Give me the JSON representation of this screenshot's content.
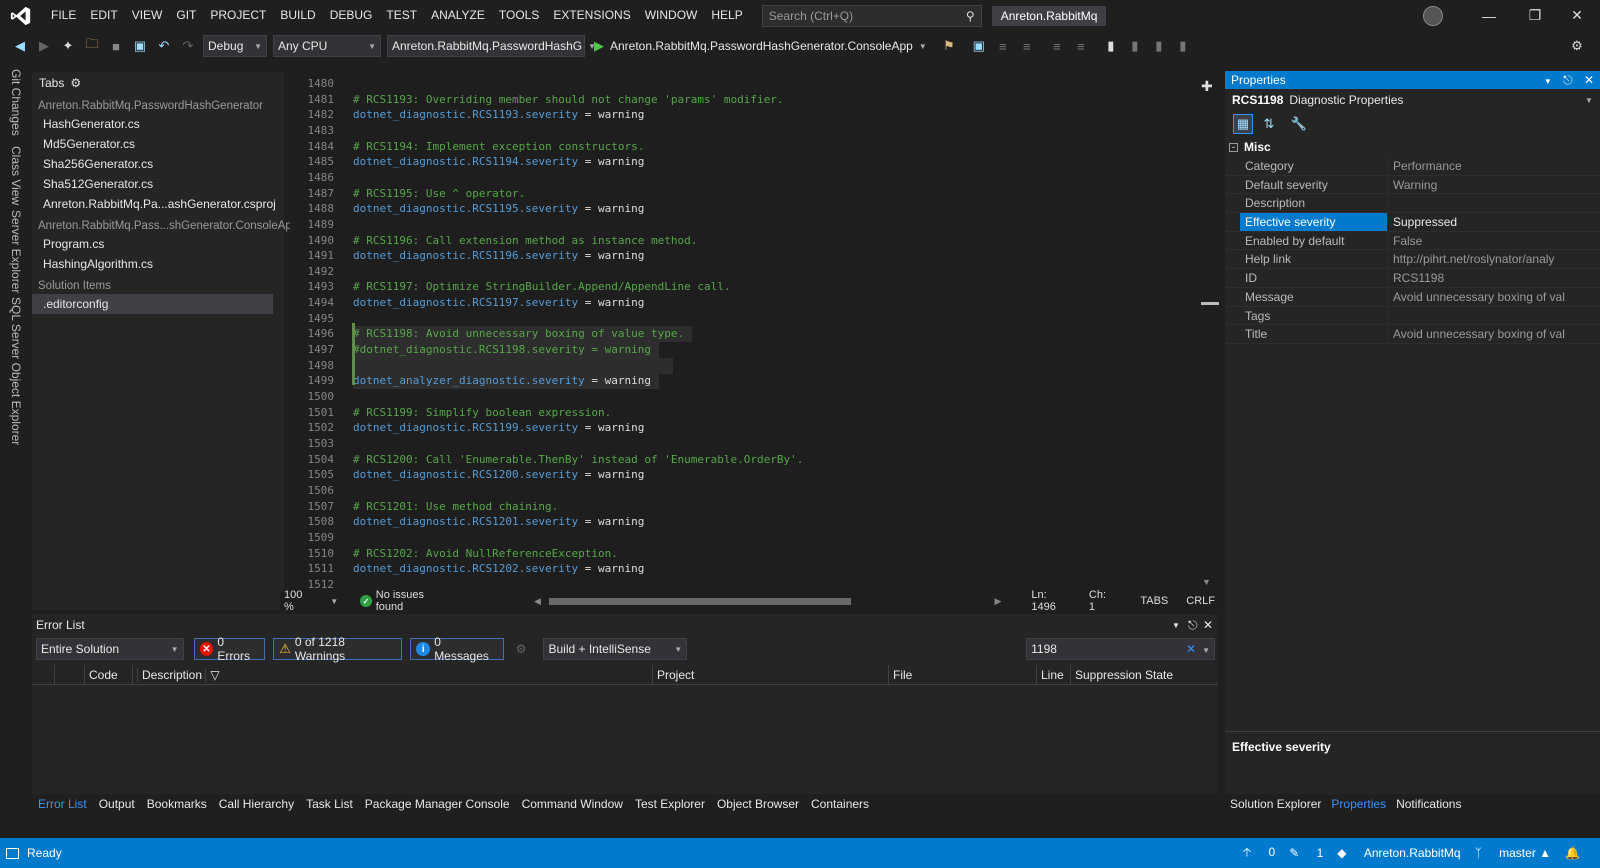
{
  "titlebar": {
    "menu": [
      "FILE",
      "EDIT",
      "VIEW",
      "GIT",
      "PROJECT",
      "BUILD",
      "DEBUG",
      "TEST",
      "ANALYZE",
      "TOOLS",
      "EXTENSIONS",
      "WINDOW",
      "HELP"
    ],
    "search_placeholder": "Search (Ctrl+Q)",
    "solution_name": "Anreton.RabbitMq"
  },
  "toolbar": {
    "config": "Debug",
    "platform": "Any CPU",
    "startup_project": "Anreton.RabbitMq.PasswordHashG",
    "run_target": "Anreton.RabbitMq.PasswordHashGenerator.ConsoleApp"
  },
  "left_tabs": [
    "Git Changes",
    "Class View",
    "Server Explorer",
    "SQL Server Object Explorer"
  ],
  "solution_panel": {
    "header": "Tabs",
    "groups": [
      {
        "name": "Anreton.RabbitMq.PasswordHashGenerator",
        "items": [
          "HashGenerator.cs",
          "Md5Generator.cs",
          "Sha256Generator.cs",
          "Sha512Generator.cs",
          "Anreton.RabbitMq.Pa...ashGenerator.csproj"
        ]
      },
      {
        "name": "Anreton.RabbitMq.Pass...shGenerator.ConsoleApp",
        "items": [
          "Program.cs",
          "HashingAlgorithm.cs"
        ]
      },
      {
        "name": "Solution Items",
        "items": [
          ".editorconfig"
        ]
      }
    ]
  },
  "editor": {
    "lines": [
      {
        "n": "1480",
        "t": "",
        "k": ""
      },
      {
        "n": "1481",
        "t": "# RCS1193: Overriding member should not change 'params' modifier.",
        "k": "c"
      },
      {
        "n": "1482",
        "t": "dotnet_diagnostic.RCS1193.severity",
        "v": " = warning",
        "k": "s"
      },
      {
        "n": "1483",
        "t": "",
        "k": ""
      },
      {
        "n": "1484",
        "t": "# RCS1194: Implement exception constructors.",
        "k": "c"
      },
      {
        "n": "1485",
        "t": "dotnet_diagnostic.RCS1194.severity",
        "v": " = warning",
        "k": "s"
      },
      {
        "n": "1486",
        "t": "",
        "k": ""
      },
      {
        "n": "1487",
        "t": "# RCS1195: Use ^ operator.",
        "k": "c"
      },
      {
        "n": "1488",
        "t": "dotnet_diagnostic.RCS1195.severity",
        "v": " = warning",
        "k": "s"
      },
      {
        "n": "1489",
        "t": "",
        "k": ""
      },
      {
        "n": "1490",
        "t": "# RCS1196: Call extension method as instance method.",
        "k": "c"
      },
      {
        "n": "1491",
        "t": "dotnet_diagnostic.RCS1196.severity",
        "v": " = warning",
        "k": "s"
      },
      {
        "n": "1492",
        "t": "",
        "k": ""
      },
      {
        "n": "1493",
        "t": "# RCS1197: Optimize StringBuilder.Append/AppendLine call.",
        "k": "c"
      },
      {
        "n": "1494",
        "t": "dotnet_diagnostic.RCS1197.severity",
        "v": " = warning",
        "k": "s"
      },
      {
        "n": "1495",
        "t": "",
        "k": ""
      },
      {
        "n": "1496",
        "t": "# RCS1198: Avoid unnecessary boxing of value type.",
        "k": "c",
        "hl": true
      },
      {
        "n": "1497",
        "t": "#dotnet_diagnostic.RCS1198.severity = warning",
        "k": "c",
        "hl": true
      },
      {
        "n": "1498",
        "t": "",
        "k": "",
        "hl": true
      },
      {
        "n": "1499",
        "t": "dotnet_analyzer_diagnostic.severity",
        "v": " = warning",
        "k": "s",
        "hl": true
      },
      {
        "n": "1500",
        "t": "",
        "k": ""
      },
      {
        "n": "1501",
        "t": "# RCS1199: Simplify boolean expression.",
        "k": "c"
      },
      {
        "n": "1502",
        "t": "dotnet_diagnostic.RCS1199.severity",
        "v": " = warning",
        "k": "s"
      },
      {
        "n": "1503",
        "t": "",
        "k": ""
      },
      {
        "n": "1504",
        "t": "# RCS1200: Call 'Enumerable.ThenBy' instead of 'Enumerable.OrderBy'.",
        "k": "c"
      },
      {
        "n": "1505",
        "t": "dotnet_diagnostic.RCS1200.severity",
        "v": " = warning",
        "k": "s"
      },
      {
        "n": "1506",
        "t": "",
        "k": ""
      },
      {
        "n": "1507",
        "t": "# RCS1201: Use method chaining.",
        "k": "c"
      },
      {
        "n": "1508",
        "t": "dotnet_diagnostic.RCS1201.severity",
        "v": " = warning",
        "k": "s"
      },
      {
        "n": "1509",
        "t": "",
        "k": ""
      },
      {
        "n": "1510",
        "t": "# RCS1202: Avoid NullReferenceException.",
        "k": "c"
      },
      {
        "n": "1511",
        "t": "dotnet_diagnostic.RCS1202.severity",
        "v": " = warning",
        "k": "s"
      },
      {
        "n": "1512",
        "t": "",
        "k": ""
      }
    ]
  },
  "editor_status": {
    "zoom": "100 %",
    "issues": "No issues found",
    "ln": "Ln: 1496",
    "ch": "Ch: 1",
    "tabs": "TABS",
    "eol": "CRLF"
  },
  "error_list": {
    "title": "Error List",
    "scope": "Entire Solution",
    "errors": "0 Errors",
    "warnings": "0 of 1218 Warnings",
    "messages": "0 Messages",
    "source": "Build + IntelliSense",
    "filter": "1198",
    "columns": [
      "Code",
      "Description",
      "Project",
      "File",
      "Line",
      "Suppression State"
    ]
  },
  "bottom_tabs": [
    "Error List",
    "Output",
    "Bookmarks",
    "Call Hierarchy",
    "Task List",
    "Package Manager Console",
    "Command Window",
    "Test Explorer",
    "Object Browser",
    "Containers"
  ],
  "properties": {
    "title": "Properties",
    "selected_object": "RCS1198",
    "selected_type": "Diagnostic Properties",
    "category": "Misc",
    "rows": [
      {
        "name": "Category",
        "value": "Performance"
      },
      {
        "name": "Default severity",
        "value": "Warning"
      },
      {
        "name": "Description",
        "value": ""
      },
      {
        "name": "Effective severity",
        "value": "Suppressed",
        "selected": true
      },
      {
        "name": "Enabled by default",
        "value": "False"
      },
      {
        "name": "Help link",
        "value": "http://pihrt.net/roslynator/analy"
      },
      {
        "name": "ID",
        "value": "RCS1198"
      },
      {
        "name": "Message",
        "value": "Avoid unnecessary boxing of val"
      },
      {
        "name": "Tags",
        "value": ""
      },
      {
        "name": "Title",
        "value": "Avoid unnecessary boxing of val"
      }
    ],
    "description_title": "Effective severity"
  },
  "right_tabs": [
    "Solution Explorer",
    "Properties",
    "Notifications"
  ],
  "statusbar": {
    "ready": "Ready",
    "up": "0",
    "pencil": "1",
    "repo": "Anreton.RabbitMq",
    "branch": "master"
  }
}
